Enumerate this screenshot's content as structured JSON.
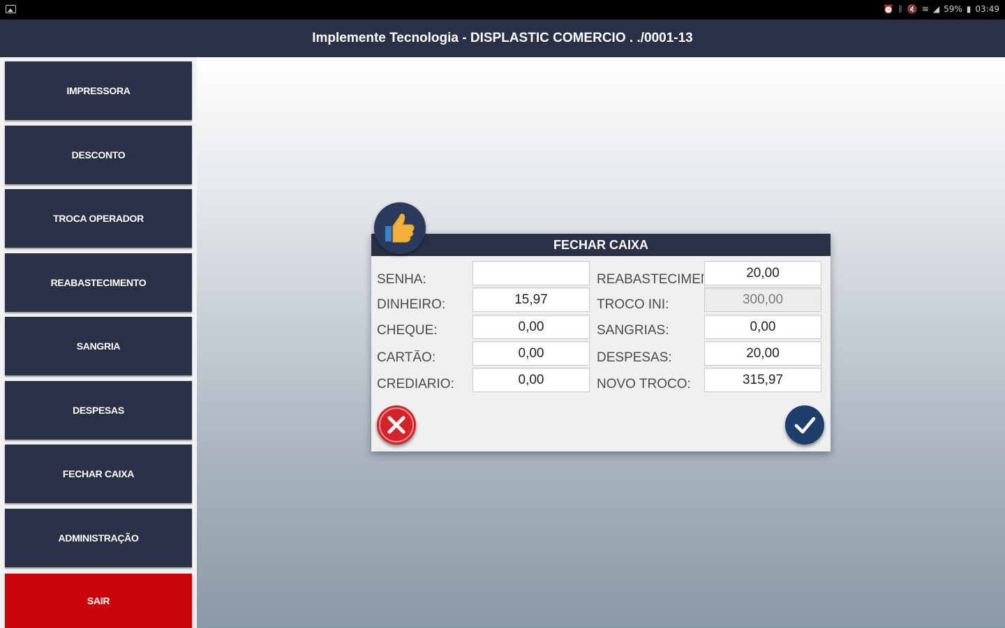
{
  "statusbar": {
    "icons": [
      "image-icon",
      "alarm-icon",
      "bluetooth-icon",
      "mute-icon",
      "wifi-icon",
      "signal-icon",
      "battery-icon"
    ],
    "battery": "59%",
    "time": "03:49"
  },
  "title": "Implemente Tecnologia - DISPLASTIC COMERCIO .            ./0001-13",
  "sidebar": {
    "items": [
      {
        "label": "IMPRESSORA"
      },
      {
        "label": "DESCONTO"
      },
      {
        "label": "TROCA OPERADOR"
      },
      {
        "label": "REABASTECIMENTO"
      },
      {
        "label": "SANGRIA"
      },
      {
        "label": "DESPESAS"
      },
      {
        "label": "FECHAR CAIXA"
      },
      {
        "label": "ADMINISTRAÇÃO"
      },
      {
        "label": "SAIR"
      }
    ]
  },
  "dialog": {
    "title": "FECHAR CAIXA",
    "icon": "thumbs-up-icon",
    "left": {
      "senha_label": "SENHA:",
      "senha_value": "",
      "dinheiro_label": "DINHEIRO:",
      "dinheiro_value": "15,97",
      "cheque_label": "CHEQUE:",
      "cheque_value": "0,00",
      "cartao_label": "CARTÃO:",
      "cartao_value": "0,00",
      "crediario_label": "CREDIARIO:",
      "crediario_value": "0,00"
    },
    "right": {
      "reabastecimento_label": "REABASTECIMENTO:",
      "reabastecimento_value": "20,00",
      "troco_ini_label": "TROCO INI:",
      "troco_ini_value": "300,00",
      "sangrias_label": "SANGRIAS:",
      "sangrias_value": "0,00",
      "despesas_label": "DESPESAS:",
      "despesas_value": "20,00",
      "novo_troco_label": "NOVO TROCO:",
      "novo_troco_value": "315,97"
    },
    "cancel_icon": "close-icon",
    "confirm_icon": "check-icon"
  },
  "colors": {
    "navy": "#2a3146",
    "exit_red": "#c8050a",
    "cancel_red": "#d3242a",
    "confirm_blue": "#1e3f6c"
  }
}
